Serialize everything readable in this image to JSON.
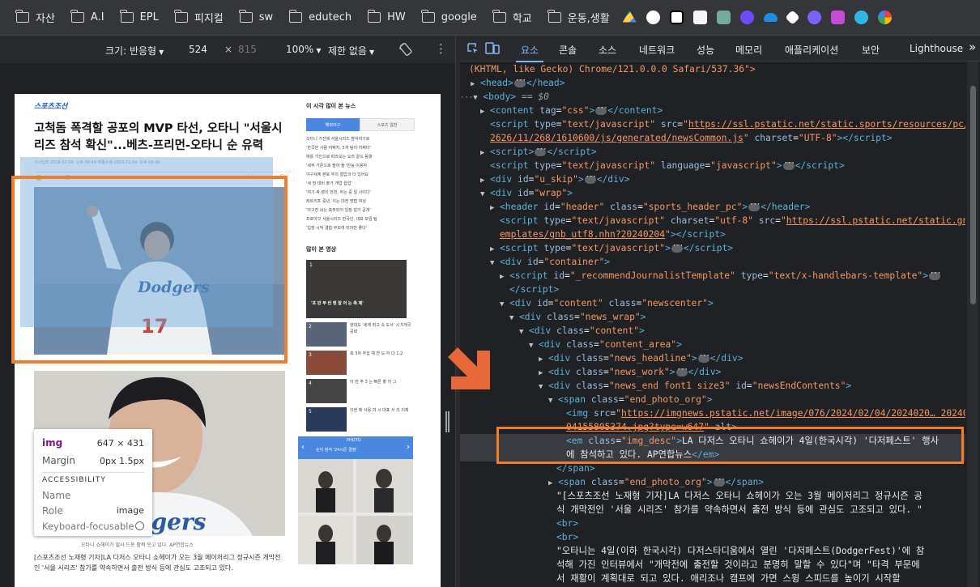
{
  "bookmarks": [
    {
      "label": "자산",
      "icon": "folder-icon"
    },
    {
      "label": "A.I",
      "icon": "folder-icon"
    },
    {
      "label": "EPL",
      "icon": "folder-icon"
    },
    {
      "label": "피지컬",
      "icon": "folder-icon"
    },
    {
      "label": "sw",
      "icon": "folder-icon"
    },
    {
      "label": "edutech",
      "icon": "folder-icon"
    },
    {
      "label": "HW",
      "icon": "folder-icon"
    },
    {
      "label": "google",
      "icon": "folder-icon"
    },
    {
      "label": "학교",
      "icon": "folder-icon"
    },
    {
      "label": "운동,생활",
      "icon": "folder-icon"
    }
  ],
  "bookmark_apps": [
    "google-drive-icon",
    "github-icon",
    "notion-icon",
    "app-icon",
    "chatgpt-icon",
    "app-icon",
    "onedrive-icon",
    "app-icon",
    "app-icon",
    "app-icon",
    "app-icon",
    "app-icon"
  ],
  "device_toolbar": {
    "size_label": "크기: 반응형",
    "width": "524",
    "times": "×",
    "height": "815",
    "zoom": "100%",
    "throttle": "제한 없음"
  },
  "page": {
    "logo": "스포츠조선",
    "headline": "고척돔 폭격할 공포의 MVP 타선, 오타니 \"서울시리즈 참석 확신\"...베츠-프리먼-오타니 순 유력",
    "meta": "기사입력 2024.02.04. 오후 08:49    최종수정 2024.02.04. 오후 08:49",
    "caption2": "오타니 쇼헤이가 필사 드용 활짝 웃고 있다. AP연합뉴스",
    "body": "[스포츠조선 노재형 기자]LA 다저스 오타니 쇼헤이가 오는 3월 메이저리그 정규시즌 개막전인 '서울 시리즈' 참가를 약속하면서 출전 방식 등에 관심도 고조되고 있다.",
    "jersey_text": "Dodgers",
    "jersey_number": "17",
    "right": {
      "popular_title": "이 시각 많이 본 뉴스",
      "tab1": "해외야구",
      "tab2": "스포츠 일반",
      "lines": [
        "오타니 가진에 서울시리즈 참석하기로",
        "'한국만 사람 어쩌지, 5개 팀이 어쩌다'",
        "애틀 가진으로 따라오는 오라 골드 동향",
        "'세부 기준으로 들어 들 '만능 이용자",
        "야구세계 본토 주의 협업과 더 있어요",
        "'세 첫 대비 출가 개업 쉽업'",
        "'여기 싸 영이 한번, 하는 중 일 사이다'",
        "레트리프 중년, 이는 대전 방법 여성",
        "'야구전 씨는 축무되어 일정 얼기 공개'",
        "프로야구 서울시리즈 한국인, 대표 모임 팀",
        "'입장 시작 결합 무보여 되어만 좋다'"
      ],
      "video_title": "많이 본 영상",
      "video_caption": "'프 반 부 씬 맨 알 어 는 축 제'",
      "videos": [
        "양대도 '세계 최고 속 도서' 시 5개국 공략",
        "축 3위 무섭 예 찬 도 하 다 1,2",
        "이 번 주 3 는 빠른 출 이 그",
        "이현 메 사용 여 시 대표 서 리 이제",
        "한 결 정비 강 개 '은 들 주 만'"
      ],
      "photo_label": "PHOTO",
      "photo_title": "순이 참석 '24시즌 결정'"
    }
  },
  "tooltip": {
    "tag": "img",
    "size": "647 × 431",
    "margin_label": "Margin",
    "margin_value": "0px 1.5px",
    "section": "ACCESSIBILITY",
    "name_label": "Name",
    "role_label": "Role",
    "role_value": "image",
    "focus_label": "Keyboard-focusable"
  },
  "devtools": {
    "tabs": [
      "요소",
      "콘솔",
      "소스",
      "네트워크",
      "성능",
      "메모리",
      "애플리케이션",
      "보안",
      "Lighthouse"
    ],
    "active_tab": "요소",
    "more": "»",
    "lines": {
      "l0": "(KHTML, like Gecko) Chrome/121.0.0.0 Safari/537.36\">",
      "head": "head",
      "body": "body",
      "body_eq": "== $0",
      "content_tag": "css",
      "src1a": "https://ssl.pstatic.net/static.sports/resources/pc/26",
      "src1b": "2626/11/268/1610600/js/generated/newsCommon.js",
      "charset1": "UTF-8",
      "lang": "javascript",
      "skip": "u_skip",
      "wrap": "wrap",
      "header_id": "header",
      "header_class": "sports_header_pc",
      "src2a": "https://ssl.pstatic.net/static.gn/t",
      "src2b": "emplates/gnb_utf8.nhn?20240204",
      "charset2": "utf-8",
      "container": "container",
      "tmpl_id": "_recommendJournalistTemplate",
      "tmpl_type": "text/x-handlebars-template",
      "content_id": "content",
      "content_class": "newscenter",
      "news_wrap": "news_wrap",
      "content": "content",
      "content_area": "content_area",
      "news_headline": "news_headline",
      "news_work": "news_work",
      "news_end": "news_end font1 size3",
      "news_end_id": "newsEndContents",
      "photo_org": "end_photo_org",
      "img_src_a": "https://imgnews.pstatic.net/image/076/2024/02/04/2024020… 202402",
      "img_src_b": "04155805374.jpg?type=w647",
      "img_desc_class": "img_desc",
      "img_desc_text_a": "LA 다저스 오타니 쇼헤이가 4일(한국시각) '다저페스트' 행사",
      "img_desc_text_b": "에 참석하고 있다. AP연합뉴스",
      "text1a": "\"[스포츠조선 노재형 기자]LA 다저스 오타니 쇼헤이가 오는 3월 메이저리그 정규시즌 공",
      "text1b": "식 개막전인 '서울 시리즈' 참가를 약속하면서 출전 방식 등에 관심도 고조되고 있다. \"",
      "br": "<br>",
      "text2a": "\"오타니는 4일(이하 한국시각) 다저스타디움에서 열린 '다저페스트(DodgerFest)'에 참",
      "text2b": "석해 가진 인터뷰에서 \"개막전에 출전할 것이라고 분명히 말할 수 있다\"며 \"타격 부문에",
      "text2c": "서 재활이 계획대로 되고 있다. 애리조나 캠프에 가면 스윙 스피드를 높이기 시작할"
    }
  },
  "colors": {
    "highlight": "#f07c2e",
    "tag": "#5db0d7",
    "attr_name": "#9bbbdc",
    "attr_value": "#f29766",
    "active_tab": "#8ab4f8"
  }
}
